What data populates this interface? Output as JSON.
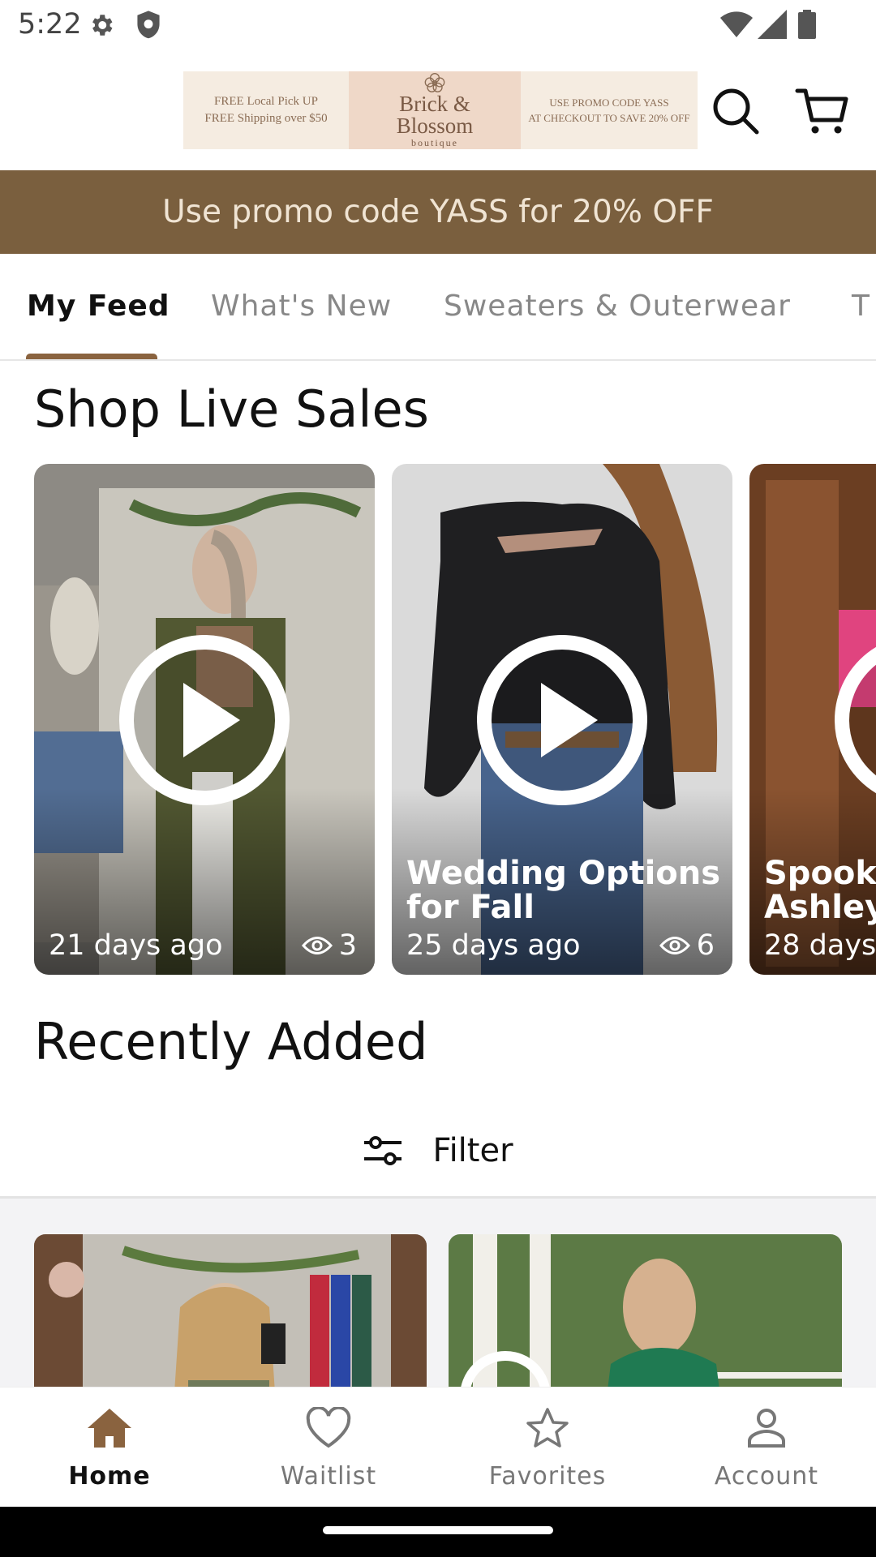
{
  "status_bar": {
    "time": "5:22"
  },
  "header": {
    "logo": {
      "left_line1": "FREE Local Pick UP",
      "left_line2": "FREE Shipping over $50",
      "brand_line1": "Brick &",
      "brand_line2": "Blossom",
      "brand_sub": "boutique",
      "right_line1": "USE PROMO CODE YASS",
      "right_line2": "AT CHECKOUT TO SAVE 20% OFF"
    }
  },
  "promo": {
    "text": "Use promo code YASS for 20% OFF"
  },
  "tabs": [
    {
      "label": "My Feed",
      "active": true
    },
    {
      "label": "What's New"
    },
    {
      "label": "Sweaters & Outerwear"
    },
    {
      "label": "T"
    }
  ],
  "live_sales": {
    "title": "Shop Live Sales",
    "cards": [
      {
        "title": "",
        "age": "21 days ago",
        "views": "3"
      },
      {
        "title": "Wedding Options for Fall",
        "age": "25 days ago",
        "views": "6"
      },
      {
        "title": "Spooky Ashley",
        "age": "28 days",
        "views": ""
      }
    ]
  },
  "recently_added": {
    "title": "Recently Added",
    "filter_label": "Filter"
  },
  "bottom_nav": [
    {
      "label": "Home",
      "icon": "home-icon",
      "active": true
    },
    {
      "label": "Waitlist",
      "icon": "heart-icon"
    },
    {
      "label": "Favorites",
      "icon": "star-icon"
    },
    {
      "label": "Account",
      "icon": "account-icon"
    }
  ],
  "colors": {
    "accent": "#7a5f3e",
    "tab_indicator": "#8a633f",
    "promo_text": "#f0e4d3"
  }
}
